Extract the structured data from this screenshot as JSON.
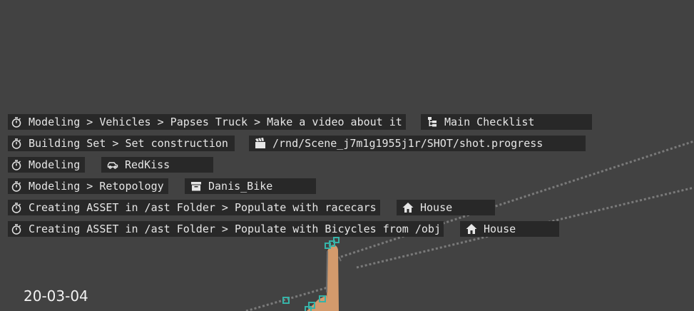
{
  "rows": [
    {
      "task": "Modeling > Vehicles > Papses Truck > Make a video about it",
      "entity": "Main Checklist",
      "entity_icon": "checklist-icon"
    },
    {
      "task": "Building Set > Set construction",
      "entity": "/rnd/Scene_j7m1g1955j1r/SHOT/shot.progress",
      "entity_icon": "clapperboard-icon"
    },
    {
      "task": "Modeling",
      "entity": "RedKiss",
      "entity_icon": "car-icon"
    },
    {
      "task": "Modeling > Retopology",
      "entity": "Danis_Bike",
      "entity_icon": "archive-icon"
    },
    {
      "task": "Creating ASSET in /ast Folder > Populate with racecars",
      "entity": "House",
      "entity_icon": "house-icon"
    },
    {
      "task": "Creating ASSET in /ast Folder > Populate with Bicycles from /obj",
      "entity": "House",
      "entity_icon": "house-icon"
    }
  ],
  "task_icon": "stopwatch-icon",
  "date": "20-03-04",
  "colors": {
    "background": "#424242",
    "label_bg": "#282828",
    "text": "#e6e6e6",
    "hand": "#d39a6c",
    "marker": "#36b3a8",
    "dotted_line": "#7a7a7a"
  }
}
